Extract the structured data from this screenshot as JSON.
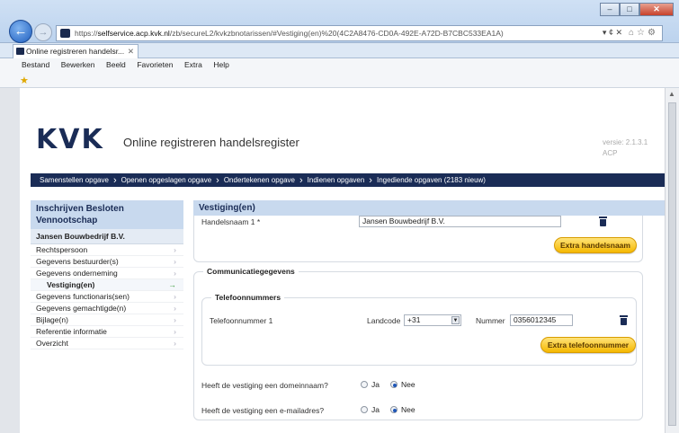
{
  "browser": {
    "url_prefix": "https://",
    "url_host": "selfservice.acp.kvk.nl",
    "url_path": "/zb/secureL2/kvkzbnotarissen/#Vestiging(en)%20(4C2A8476-CD0A-492E-A72D-B7CBC533EA1A)",
    "addr_controls": "▾ ¢ ✕",
    "tab_title": "Online registreren handelsr...",
    "menu": [
      "Bestand",
      "Bewerken",
      "Beeld",
      "Favorieten",
      "Extra",
      "Help"
    ]
  },
  "header": {
    "logo": "KVK",
    "title": "Online registreren handelsregister",
    "version_line1": "versie: 2.1.3.1",
    "version_line2": "ACP"
  },
  "wizard": {
    "steps": [
      "Samenstellen opgave",
      "Openen opgeslagen opgave",
      "Ondertekenen opgave",
      "Indienen opgaven",
      "Ingediende opgaven (2183 nieuw)"
    ]
  },
  "sidebar": {
    "heading": "Inschrijven Besloten Vennootschap",
    "company": "Jansen Bouwbedrijf B.V.",
    "items": [
      {
        "label": "Rechtspersoon",
        "active": false
      },
      {
        "label": "Gegevens bestuurder(s)",
        "active": false
      },
      {
        "label": "Gegevens onderneming",
        "active": false
      },
      {
        "label": "Vestiging(en)",
        "active": true
      },
      {
        "label": "Gegevens functionaris(sen)",
        "active": false
      },
      {
        "label": "Gegevens gemachtigde(n)",
        "active": false
      },
      {
        "label": "Bijlage(n)",
        "active": false
      },
      {
        "label": "Referentie informatie",
        "active": false
      },
      {
        "label": "Overzicht",
        "active": false
      }
    ]
  },
  "main": {
    "heading": "Vestiging(en)",
    "handelsnaam_label": "Handelsnaam 1 *",
    "handelsnaam_value": "Jansen Bouwbedrijf B.V.",
    "extra_handelsnaam": "Extra handelsnaam",
    "communicatie_legend": "Communicatiegegevens",
    "telefoon_legend": "Telefoonnummers",
    "telefoon_label": "Telefoonnummer 1",
    "landcode_label": "Landcode",
    "landcode_value": "+31",
    "nummer_label": "Nummer",
    "nummer_value": "0356012345",
    "extra_telefoon": "Extra telefoonnummer",
    "domein_question": "Heeft de vestiging een domeinnaam?",
    "email_question": "Heeft de vestiging een e-mailadres?",
    "ja": "Ja",
    "nee": "Nee",
    "domein_selected": "Nee",
    "email_selected": "Nee"
  },
  "colors": {
    "brand": "#1a2c56",
    "accent_button": "#f5b800"
  }
}
